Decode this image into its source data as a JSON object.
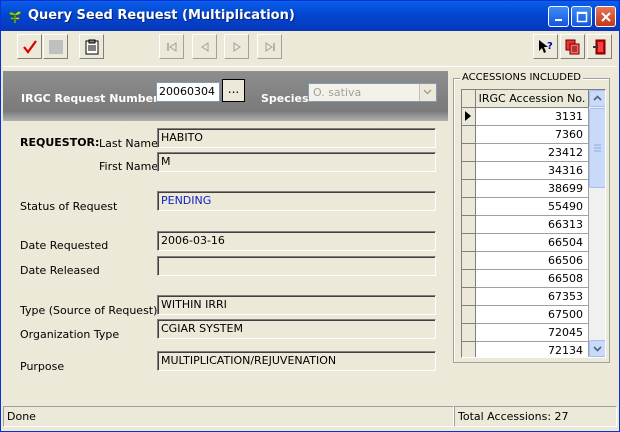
{
  "window": {
    "title": "Query Seed Request (Multiplication)"
  },
  "toolbar": {
    "buttons": [
      "checkmark-icon",
      "blank-icon",
      "clipboard-icon"
    ],
    "nav": [
      "first-record-icon",
      "previous-record-icon",
      "next-record-icon",
      "last-record-icon"
    ],
    "right": [
      "help-icon",
      "copy-icon",
      "exit-door-icon"
    ]
  },
  "header": {
    "request_label": "IRGC Request Number",
    "request_value": "20060304",
    "browse_label": "...",
    "species_label": "Species",
    "species_value": "O. sativa"
  },
  "form": {
    "requestor_label": "REQUESTOR:",
    "last_name_label": "Last Name",
    "last_name_value": "HABITO",
    "first_name_label": "First Name",
    "first_name_value": "M",
    "status_label": "Status of Request",
    "status_value": "PENDING",
    "date_requested_label": "Date Requested",
    "date_requested_value": "2006-03-16",
    "date_released_label": "Date Released",
    "date_released_value": "",
    "type_label": "Type (Source of Request)",
    "type_value": "WITHIN IRRI",
    "org_type_label": "Organization Type",
    "org_type_value": "CGIAR SYSTEM",
    "purpose_label": "Purpose",
    "purpose_value": "MULTIPLICATION/REJUVENATION"
  },
  "accessions": {
    "title": "ACCESSIONS INCLUDED",
    "column_header": "IRGC Accession No.",
    "rows": [
      "3131",
      "7360",
      "23412",
      "34316",
      "38699",
      "55490",
      "66313",
      "66504",
      "66506",
      "66508",
      "67353",
      "67500",
      "72045",
      "72134"
    ]
  },
  "status": {
    "message": "Done",
    "total": "Total Accessions: 27"
  },
  "colors": {
    "title_bar": "#0247D4",
    "band": "#808080",
    "status_blue": "#1020C0"
  }
}
